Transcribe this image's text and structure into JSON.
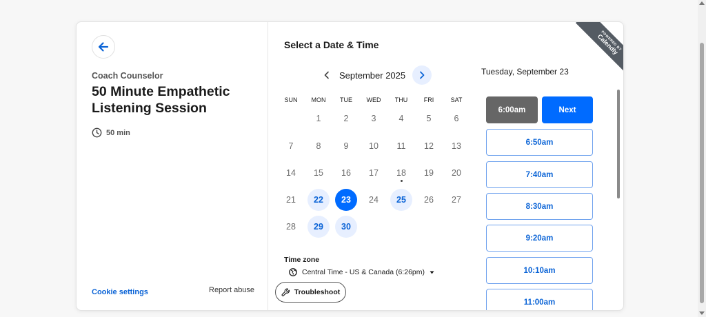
{
  "left": {
    "organizer": "Coach Counselor",
    "title": "50 Minute Empathetic Listening Session",
    "duration": "50 min",
    "cookie_settings": "Cookie settings",
    "report_abuse": "Report abuse"
  },
  "calendar": {
    "heading": "Select a Date & Time",
    "month": "September 2025",
    "weekdays": [
      "SUN",
      "MON",
      "TUE",
      "WED",
      "THU",
      "FRI",
      "SAT"
    ],
    "weeks": [
      [
        "",
        "1",
        "2",
        "3",
        "4",
        "5",
        "6"
      ],
      [
        "7",
        "8",
        "9",
        "10",
        "11",
        "12",
        "13"
      ],
      [
        "14",
        "15",
        "16",
        "17",
        "18",
        "19",
        "20"
      ],
      [
        "21",
        "22",
        "23",
        "24",
        "25",
        "26",
        "27"
      ],
      [
        "28",
        "29",
        "30",
        "",
        "",
        "",
        ""
      ]
    ],
    "available_days": [
      "22",
      "25",
      "29",
      "30"
    ],
    "selected_day": "23",
    "today_marker_day": "18"
  },
  "timezone": {
    "label": "Time zone",
    "value": "Central Time - US & Canada (6:26pm)"
  },
  "troubleshoot_label": "Troubleshoot",
  "times": {
    "date_heading": "Tuesday, September 23",
    "selected_slot": "6:00am",
    "next_label": "Next",
    "slots": [
      "6:50am",
      "7:40am",
      "8:30am",
      "9:20am",
      "10:10am",
      "11:00am"
    ]
  },
  "ribbon": {
    "line1": "POWERED BY",
    "line2": "Calendly"
  },
  "colors": {
    "primary": "#006bff",
    "available_bg": "#e7efff",
    "selected_slot_bg": "#666666",
    "ribbon_bg": "#545b63"
  }
}
